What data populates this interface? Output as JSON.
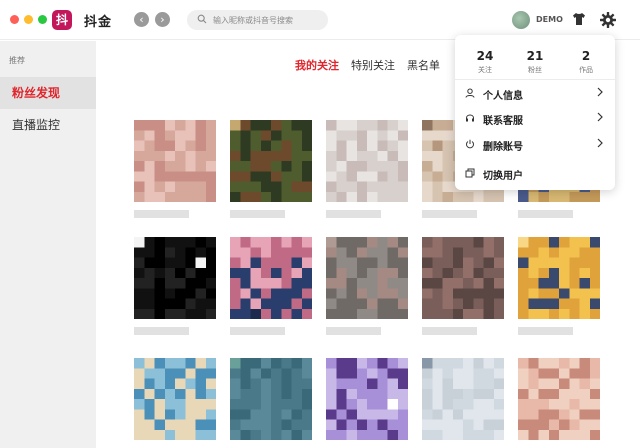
{
  "app": {
    "title": "抖金",
    "logo_text": "抖",
    "user_name": "DEMO"
  },
  "search": {
    "placeholder": "输入昵称或抖音号搜索"
  },
  "sidebar": {
    "heading": "推荐",
    "items": [
      {
        "label": "粉丝发现"
      },
      {
        "label": "直播监控"
      }
    ]
  },
  "tabs": [
    {
      "label": "我的关注"
    },
    {
      "label": "特别关注"
    },
    {
      "label": "黑名单"
    }
  ],
  "dropdown": {
    "stats": [
      {
        "value": "24",
        "label": "关注"
      },
      {
        "value": "21",
        "label": "粉丝"
      },
      {
        "value": "2",
        "label": "作品"
      }
    ],
    "items": [
      {
        "label": "个人信息"
      },
      {
        "label": "联系客服"
      },
      {
        "label": "删除账号"
      },
      {
        "label": "切换用户"
      }
    ]
  },
  "colors": {
    "accent": "#e0262c",
    "sidebar_bg": "#f0f0f0",
    "logo_bg": "#c2185b"
  },
  "icons": [
    "search-icon",
    "back-icon",
    "forward-icon",
    "shirt-icon",
    "gear-icon",
    "user-icon",
    "headset-icon",
    "power-icon",
    "switch-user-icon",
    "chevron-right-icon"
  ]
}
